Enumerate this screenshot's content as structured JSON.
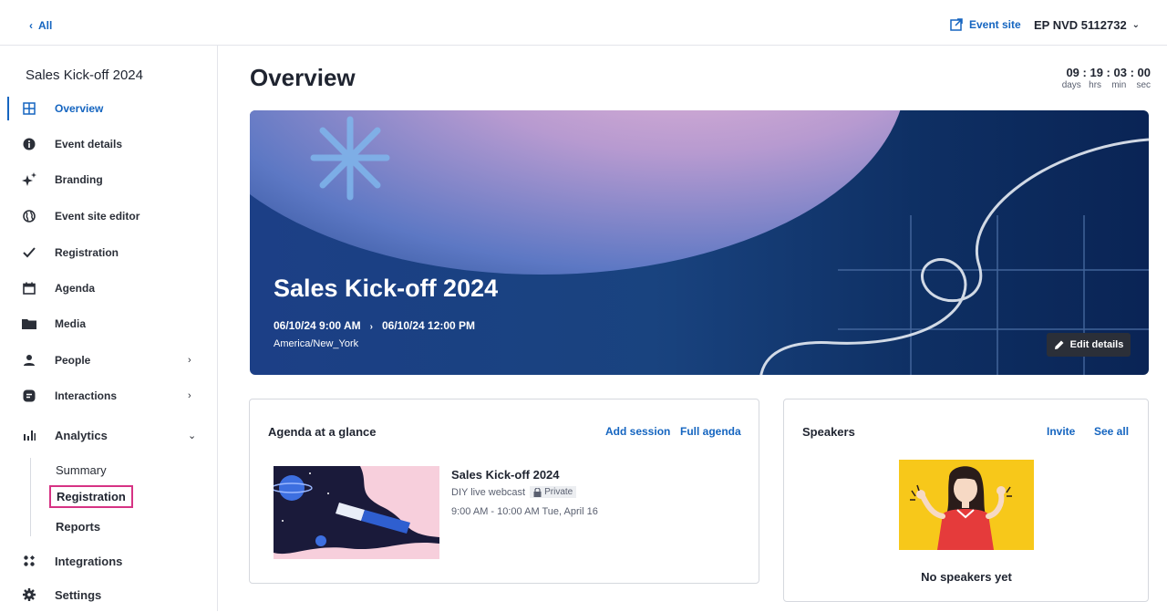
{
  "topbar": {
    "back_label": "All",
    "event_site_label": "Event site",
    "event_id_label": "EP NVD 5112732"
  },
  "sidebar": {
    "event_title": "Sales Kick-off 2024",
    "items": [
      {
        "label": "Overview",
        "icon": "grid-icon"
      },
      {
        "label": "Event details",
        "icon": "info-icon"
      },
      {
        "label": "Branding",
        "icon": "sparkle-icon"
      },
      {
        "label": "Event site editor",
        "icon": "globe-icon"
      },
      {
        "label": "Registration",
        "icon": "check-icon"
      },
      {
        "label": "Agenda",
        "icon": "calendar-icon"
      },
      {
        "label": "Media",
        "icon": "folder-icon"
      },
      {
        "label": "People",
        "icon": "person-icon"
      },
      {
        "label": "Interactions",
        "icon": "chat-icon"
      },
      {
        "label": "Analytics",
        "icon": "bar-chart-icon"
      }
    ],
    "analytics_sub": [
      "Summary",
      "Registration",
      "Reports"
    ],
    "bottom_items": [
      {
        "label": "Integrations",
        "icon": "integrations-icon"
      },
      {
        "label": "Settings",
        "icon": "gear-icon"
      }
    ]
  },
  "main": {
    "page_title": "Overview",
    "countdown": {
      "days": "09",
      "hrs": "19",
      "min": "03",
      "sec": "00",
      "units": {
        "days": "days",
        "hrs": "hrs",
        "min": "min",
        "sec": "sec"
      }
    },
    "hero": {
      "title": "Sales Kick-off 2024",
      "start": "06/10/24 9:00 AM",
      "end": "06/10/24 12:00 PM",
      "timezone": "America/New_York",
      "edit_label": "Edit details"
    },
    "agenda": {
      "title": "Agenda at a glance",
      "add_session": "Add session",
      "full_agenda": "Full agenda",
      "session": {
        "name": "Sales Kick-off 2024",
        "type": "DIY live webcast",
        "badge": "Private",
        "time": "9:00 AM - 10:00 AM Tue, April 16"
      }
    },
    "speakers": {
      "title": "Speakers",
      "invite": "Invite",
      "see_all": "See all",
      "empty": "No speakers yet"
    }
  },
  "colors": {
    "accent": "#1565c0",
    "highlight": "#d63384",
    "hero_dark": "#0a2455",
    "speaker_bg": "#f7c81a"
  }
}
